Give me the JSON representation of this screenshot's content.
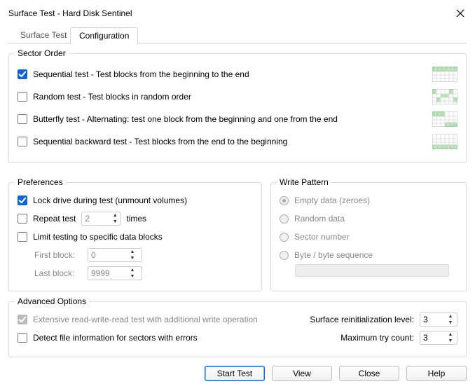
{
  "window": {
    "title": "Surface Test - Hard Disk Sentinel"
  },
  "tabs": {
    "surface": "Surface Test",
    "config": "Configuration"
  },
  "sectorOrder": {
    "title": "Sector Order",
    "sequential": "Sequential test - Test blocks from the beginning to the end",
    "random": "Random test - Test blocks in random order",
    "butterfly": "Butterfly test - Alternating: test one block from the beginning and one from the end",
    "backward": "Sequential backward test - Test blocks from the end to the beginning"
  },
  "prefs": {
    "title": "Preferences",
    "lock": "Lock drive during test (unmount volumes)",
    "repeat": "Repeat test",
    "repeatTimes": "times",
    "repeatValue": "2",
    "limit": "Limit testing to specific data blocks",
    "first": "First block:",
    "firstValue": "0",
    "last": "Last block:",
    "lastValue": "9999"
  },
  "write": {
    "title": "Write Pattern",
    "empty": "Empty data (zeroes)",
    "random": "Random data",
    "sector": "Sector number",
    "byte": "Byte / byte sequence"
  },
  "adv": {
    "title": "Advanced Options",
    "extensive": "Extensive read-write-read test with additional write operation",
    "detect": "Detect file information for sectors with errors",
    "reinit": "Surface reinitialization level:",
    "reinitValue": "3",
    "maxtry": "Maximum try count:",
    "maxtryValue": "3"
  },
  "buttons": {
    "start": "Start Test",
    "view": "View",
    "close": "Close",
    "help": "Help"
  }
}
